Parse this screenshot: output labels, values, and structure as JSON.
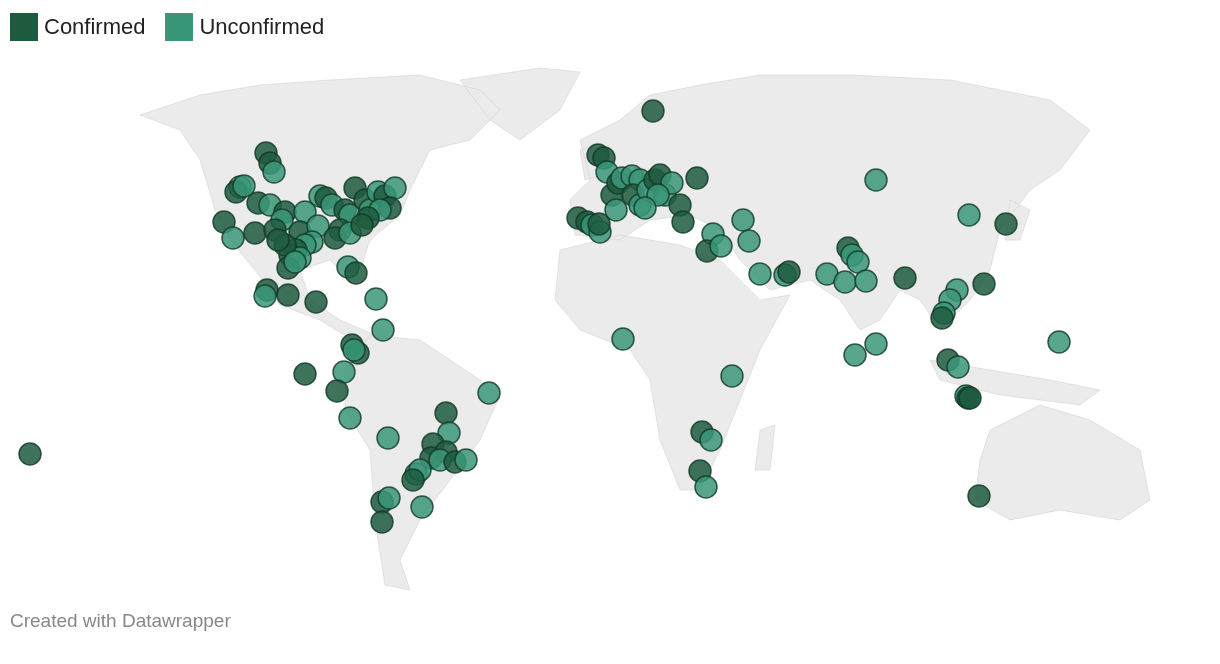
{
  "legend": [
    {
      "label": "Confirmed",
      "color": "#1d5a3e"
    },
    {
      "label": "Unconfirmed",
      "color": "#3a9679"
    }
  ],
  "map": {
    "markers": [
      {
        "kind": "confirmed"
      },
      {
        "kind": "confirmed"
      },
      {
        "kind": "unconfirmed"
      },
      {
        "kind": "unconfirmed"
      },
      {
        "kind": "confirmed"
      },
      {
        "kind": "unconfirmed"
      },
      {
        "kind": "confirmed"
      },
      {
        "kind": "unconfirmed"
      },
      {
        "kind": "confirmed"
      },
      {
        "kind": "unconfirmed"
      },
      {
        "kind": "unconfirmed"
      },
      {
        "kind": "confirmed"
      },
      {
        "kind": "unconfirmed"
      },
      {
        "kind": "confirmed"
      },
      {
        "kind": "confirmed"
      },
      {
        "kind": "confirmed"
      },
      {
        "kind": "unconfirmed"
      },
      {
        "kind": "unconfirmed"
      },
      {
        "kind": "confirmed"
      },
      {
        "kind": "unconfirmed"
      },
      {
        "kind": "confirmed"
      },
      {
        "kind": "unconfirmed"
      },
      {
        "kind": "confirmed"
      },
      {
        "kind": "confirmed"
      },
      {
        "kind": "unconfirmed"
      },
      {
        "kind": "confirmed"
      },
      {
        "kind": "confirmed"
      },
      {
        "kind": "unconfirmed"
      },
      {
        "kind": "unconfirmed"
      },
      {
        "kind": "confirmed"
      },
      {
        "kind": "unconfirmed"
      },
      {
        "kind": "confirmed"
      },
      {
        "kind": "unconfirmed"
      },
      {
        "kind": "confirmed"
      },
      {
        "kind": "confirmed"
      },
      {
        "kind": "unconfirmed"
      },
      {
        "kind": "unconfirmed"
      },
      {
        "kind": "confirmed"
      },
      {
        "kind": "confirmed"
      },
      {
        "kind": "unconfirmed"
      },
      {
        "kind": "confirmed"
      },
      {
        "kind": "confirmed"
      },
      {
        "kind": "confirmed"
      },
      {
        "kind": "unconfirmed"
      },
      {
        "kind": "unconfirmed"
      },
      {
        "kind": "confirmed"
      },
      {
        "kind": "confirmed"
      },
      {
        "kind": "unconfirmed"
      },
      {
        "kind": "confirmed"
      },
      {
        "kind": "confirmed"
      },
      {
        "kind": "unconfirmed"
      },
      {
        "kind": "unconfirmed"
      },
      {
        "kind": "confirmed"
      },
      {
        "kind": "confirmed"
      },
      {
        "kind": "unconfirmed"
      },
      {
        "kind": "confirmed"
      },
      {
        "kind": "unconfirmed"
      },
      {
        "kind": "confirmed"
      },
      {
        "kind": "unconfirmed"
      },
      {
        "kind": "unconfirmed"
      },
      {
        "kind": "confirmed"
      },
      {
        "kind": "unconfirmed"
      },
      {
        "kind": "confirmed"
      },
      {
        "kind": "confirmed"
      },
      {
        "kind": "confirmed"
      },
      {
        "kind": "unconfirmed"
      },
      {
        "kind": "confirmed"
      },
      {
        "kind": "unconfirmed"
      },
      {
        "kind": "unconfirmed"
      },
      {
        "kind": "unconfirmed"
      },
      {
        "kind": "confirmed"
      },
      {
        "kind": "confirmed"
      },
      {
        "kind": "unconfirmed"
      },
      {
        "kind": "confirmed"
      },
      {
        "kind": "unconfirmed"
      },
      {
        "kind": "unconfirmed"
      },
      {
        "kind": "confirmed"
      },
      {
        "kind": "confirmed"
      },
      {
        "kind": "confirmed"
      },
      {
        "kind": "confirmed"
      },
      {
        "kind": "unconfirmed"
      },
      {
        "kind": "confirmed"
      },
      {
        "kind": "confirmed"
      },
      {
        "kind": "unconfirmed"
      },
      {
        "kind": "unconfirmed"
      },
      {
        "kind": "unconfirmed"
      },
      {
        "kind": "unconfirmed"
      },
      {
        "kind": "confirmed"
      },
      {
        "kind": "unconfirmed"
      },
      {
        "kind": "unconfirmed"
      },
      {
        "kind": "confirmed"
      },
      {
        "kind": "confirmed"
      },
      {
        "kind": "unconfirmed"
      },
      {
        "kind": "unconfirmed"
      },
      {
        "kind": "unconfirmed"
      },
      {
        "kind": "unconfirmed"
      },
      {
        "kind": "confirmed"
      },
      {
        "kind": "confirmed"
      },
      {
        "kind": "confirmed"
      },
      {
        "kind": "confirmed"
      },
      {
        "kind": "confirmed"
      },
      {
        "kind": "unconfirmed"
      },
      {
        "kind": "unconfirmed"
      },
      {
        "kind": "confirmed"
      },
      {
        "kind": "unconfirmed"
      },
      {
        "kind": "unconfirmed"
      },
      {
        "kind": "confirmed"
      },
      {
        "kind": "unconfirmed"
      },
      {
        "kind": "unconfirmed"
      },
      {
        "kind": "unconfirmed"
      },
      {
        "kind": "unconfirmed"
      },
      {
        "kind": "confirmed"
      },
      {
        "kind": "unconfirmed"
      },
      {
        "kind": "unconfirmed"
      },
      {
        "kind": "confirmed"
      },
      {
        "kind": "unconfirmed"
      },
      {
        "kind": "confirmed"
      },
      {
        "kind": "unconfirmed"
      },
      {
        "kind": "unconfirmed"
      },
      {
        "kind": "unconfirmed"
      },
      {
        "kind": "confirmed"
      },
      {
        "kind": "unconfirmed"
      },
      {
        "kind": "unconfirmed"
      },
      {
        "kind": "confirmed"
      },
      {
        "kind": "unconfirmed"
      },
      {
        "kind": "unconfirmed"
      },
      {
        "kind": "unconfirmed"
      },
      {
        "kind": "confirmed"
      },
      {
        "kind": "unconfirmed"
      },
      {
        "kind": "confirmed"
      },
      {
        "kind": "unconfirmed"
      },
      {
        "kind": "unconfirmed"
      },
      {
        "kind": "confirmed"
      },
      {
        "kind": "unconfirmed"
      },
      {
        "kind": "unconfirmed"
      },
      {
        "kind": "confirmed"
      },
      {
        "kind": "unconfirmed"
      },
      {
        "kind": "unconfirmed"
      },
      {
        "kind": "confirmed"
      },
      {
        "kind": "confirmed"
      },
      {
        "kind": "confirmed"
      },
      {
        "kind": "unconfirmed"
      }
    ]
  },
  "footer": "Created with Datawrapper"
}
